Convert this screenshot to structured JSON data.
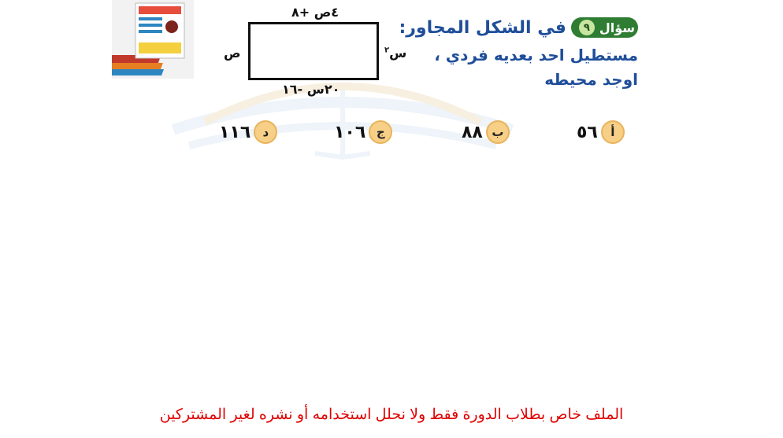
{
  "question": {
    "badge_label": "سؤال",
    "number": "٩",
    "title": "في الشكل المجاور:",
    "line2": "مستطيل احد بعديه فردي ،",
    "line3": "اوجد محيطه"
  },
  "figure": {
    "top_label": "٤ص +٨",
    "bottom_label": "٢٠س -١٦",
    "left_label": "ص",
    "right_label_base": "س",
    "right_label_sup": "٢"
  },
  "options": [
    {
      "letter": "أ",
      "value": "٥٦"
    },
    {
      "letter": "ب",
      "value": "٨٨"
    },
    {
      "letter": "ج",
      "value": "١٠٦"
    },
    {
      "letter": "د",
      "value": "١١٦"
    }
  ],
  "footer": "الملف خاص بطلاب الدورة فقط ولا نحلل استخدامه أو نشره لغير المشتركين",
  "colors": {
    "title": "#1f4e9a",
    "badge": "#2f7d32",
    "option_circle": "#f7cf86",
    "footer": "#e00000"
  }
}
